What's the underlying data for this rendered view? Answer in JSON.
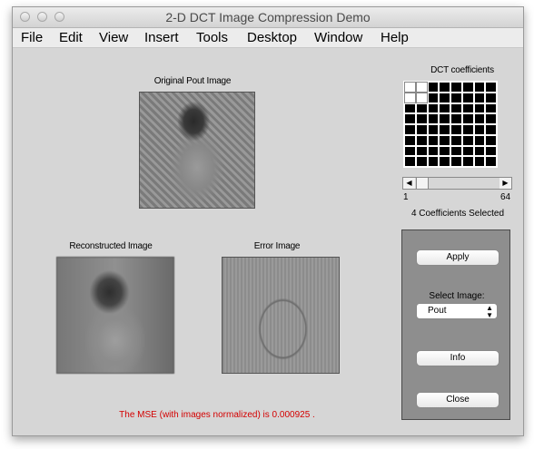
{
  "window": {
    "title": "2-D DCT Image Compression Demo"
  },
  "menu": [
    "File",
    "Edit",
    "View",
    "Insert",
    "Tools",
    "Desktop",
    "Window",
    "Help"
  ],
  "axes": {
    "original_title": "Original Pout Image",
    "reconstructed_title": "Reconstructed Image",
    "error_title": "Error Image",
    "dct_title": "DCT coefficients"
  },
  "dct_grid": {
    "rows": 8,
    "cols": 8,
    "selected_cells": [
      "0-0",
      "0-1",
      "1-0",
      "1-1"
    ]
  },
  "slider": {
    "min_label": "1",
    "max_label": "64",
    "value": 4,
    "status": "4 Coefficients Selected"
  },
  "panel": {
    "apply_label": "Apply",
    "select_label": "Select Image:",
    "select_value": "Pout",
    "info_label": "Info",
    "close_label": "Close"
  },
  "mse_text": "The MSE (with images normalized) is 0.000925 ."
}
